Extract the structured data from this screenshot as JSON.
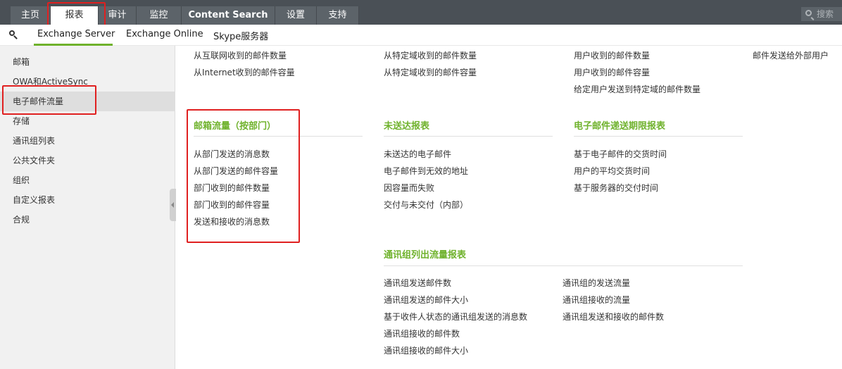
{
  "topnav": {
    "tabs": [
      "主页",
      "报表",
      "审计",
      "监控",
      "Content Search",
      "设置",
      "支持"
    ],
    "active_index": 1,
    "search_placeholder": "搜索"
  },
  "subnav": {
    "tabs": [
      "Exchange Server",
      "Exchange Online",
      "Skype服务器"
    ],
    "active_index": 0
  },
  "sidebar": {
    "items": [
      "邮箱",
      "OWA和ActiveSync",
      "电子邮件流量",
      "存储",
      "通讯组列表",
      "公共文件夹",
      "组织",
      "自定义报表",
      "合规"
    ],
    "selected_index": 2
  },
  "content": {
    "top_col1": [
      "从互联网收到的邮件数量",
      "从Internet收到的邮件容量"
    ],
    "top_col2": [
      "从特定域收到的邮件数量",
      "从特定域收到的邮件容量"
    ],
    "top_col3": [
      "用户收到的邮件数量",
      "用户收到的邮件容量",
      "给定用户发送到特定域的邮件数量"
    ],
    "top_col4": [
      "邮件发送给外部用户"
    ],
    "sections": {
      "mailbox_dept": {
        "title": "邮箱流量（按部门）",
        "items": [
          "从部门发送的消息数",
          "从部门发送的邮件容量",
          "部门收到的邮件数量",
          "部门收到的邮件容量",
          "发送和接收的消息数"
        ]
      },
      "undelivered": {
        "title": "未送达报表",
        "items": [
          "未送达的电子邮件",
          "电子邮件到无效的地址",
          "因容量而失败",
          "交付与未交付（内部）"
        ]
      },
      "sla": {
        "title": "电子邮件递送期限报表",
        "items": [
          "基于电子邮件的交货时间",
          "用户的平均交货时间",
          "基于服务器的交付时间"
        ]
      },
      "dl_outbound": {
        "title": "通讯组列出流量报表",
        "col1": [
          "通讯组发送邮件数",
          "通讯组发送的邮件大小",
          "基于收件人状态的通讯组发送的消息数",
          "通讯组接收的邮件数",
          "通讯组接收的邮件大小"
        ],
        "col2": [
          "通讯组的发送流量",
          "通讯组接收的流量",
          "通讯组发送和接收的邮件数"
        ]
      }
    }
  }
}
